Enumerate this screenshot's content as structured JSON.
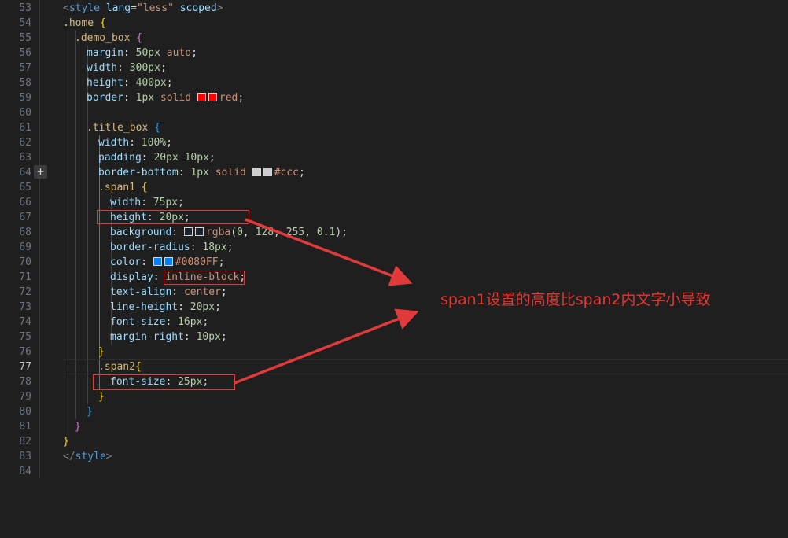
{
  "editor": {
    "current_line": 77,
    "fold_icon": "plus-icon",
    "lines": [
      {
        "n": "53",
        "indent": 80,
        "tokens": [
          {
            "t": "<",
            "c": "c-punct"
          },
          {
            "t": "style",
            "c": "c-tag"
          },
          {
            "t": " ",
            "c": "c-text"
          },
          {
            "t": "lang",
            "c": "c-attr"
          },
          {
            "t": "=",
            "c": "c-text"
          },
          {
            "t": "\"less\"",
            "c": "c-str"
          },
          {
            "t": " ",
            "c": "c-text"
          },
          {
            "t": "scoped",
            "c": "c-attr"
          },
          {
            "t": ">",
            "c": "c-punct"
          }
        ]
      },
      {
        "n": "54",
        "indent": 80,
        "tokens": [
          {
            "t": ".home",
            "c": "c-sel"
          },
          {
            "t": " ",
            "c": "c-text"
          },
          {
            "t": "{",
            "c": "c-b1"
          }
        ]
      },
      {
        "n": "55",
        "indent": 95,
        "tokens": [
          {
            "t": ".demo_box",
            "c": "c-sel"
          },
          {
            "t": " ",
            "c": "c-text"
          },
          {
            "t": "{",
            "c": "c-b2"
          }
        ]
      },
      {
        "n": "56",
        "indent": 110,
        "tokens": [
          {
            "t": "margin",
            "c": "c-prop"
          },
          {
            "t": ": ",
            "c": "c-text"
          },
          {
            "t": "50px",
            "c": "c-num"
          },
          {
            "t": " ",
            "c": "c-text"
          },
          {
            "t": "auto",
            "c": "c-val"
          },
          {
            "t": ";",
            "c": "c-text"
          }
        ]
      },
      {
        "n": "57",
        "indent": 110,
        "tokens": [
          {
            "t": "width",
            "c": "c-prop"
          },
          {
            "t": ": ",
            "c": "c-text"
          },
          {
            "t": "300px",
            "c": "c-num"
          },
          {
            "t": ";",
            "c": "c-text"
          }
        ]
      },
      {
        "n": "58",
        "indent": 110,
        "tokens": [
          {
            "t": "height",
            "c": "c-prop"
          },
          {
            "t": ": ",
            "c": "c-text"
          },
          {
            "t": "400px",
            "c": "c-num"
          },
          {
            "t": ";",
            "c": "c-text"
          }
        ]
      },
      {
        "n": "59",
        "indent": 110,
        "tokens": [
          {
            "t": "border",
            "c": "c-prop"
          },
          {
            "t": ": ",
            "c": "c-text"
          },
          {
            "t": "1px",
            "c": "c-num"
          },
          {
            "t": " ",
            "c": "c-text"
          },
          {
            "t": "solid",
            "c": "c-val"
          },
          {
            "t": " ",
            "c": "c-text"
          },
          {
            "swatch": "#ff0000"
          },
          {
            "swatch": "#ff0000"
          },
          {
            "t": "red",
            "c": "c-val"
          },
          {
            "t": ";",
            "c": "c-text"
          }
        ]
      },
      {
        "n": "60",
        "indent": 110,
        "tokens": []
      },
      {
        "n": "61",
        "indent": 110,
        "tokens": [
          {
            "t": ".title_box",
            "c": "c-sel"
          },
          {
            "t": " ",
            "c": "c-text"
          },
          {
            "t": "{",
            "c": "c-b3"
          }
        ]
      },
      {
        "n": "62",
        "indent": 125,
        "tokens": [
          {
            "t": "width",
            "c": "c-prop"
          },
          {
            "t": ": ",
            "c": "c-text"
          },
          {
            "t": "100%",
            "c": "c-num"
          },
          {
            "t": ";",
            "c": "c-text"
          }
        ]
      },
      {
        "n": "63",
        "indent": 125,
        "tokens": [
          {
            "t": "padding",
            "c": "c-prop"
          },
          {
            "t": ": ",
            "c": "c-text"
          },
          {
            "t": "20px",
            "c": "c-num"
          },
          {
            "t": " ",
            "c": "c-text"
          },
          {
            "t": "10px",
            "c": "c-num"
          },
          {
            "t": ";",
            "c": "c-text"
          }
        ]
      },
      {
        "n": "64",
        "indent": 125,
        "tokens": [
          {
            "t": "border-bottom",
            "c": "c-prop"
          },
          {
            "t": ": ",
            "c": "c-text"
          },
          {
            "t": "1px",
            "c": "c-num"
          },
          {
            "t": " ",
            "c": "c-text"
          },
          {
            "t": "solid",
            "c": "c-val"
          },
          {
            "t": " ",
            "c": "c-text"
          },
          {
            "swatch": "#cccccc"
          },
          {
            "swatch": "#cccccc"
          },
          {
            "t": "#ccc",
            "c": "c-val"
          },
          {
            "t": ";",
            "c": "c-text"
          }
        ]
      },
      {
        "n": "65",
        "indent": 125,
        "tokens": [
          {
            "t": ".span1",
            "c": "c-sel"
          },
          {
            "t": " ",
            "c": "c-text"
          },
          {
            "t": "{",
            "c": "c-b1"
          }
        ]
      },
      {
        "n": "66",
        "indent": 140,
        "tokens": [
          {
            "t": "width",
            "c": "c-prop"
          },
          {
            "t": ": ",
            "c": "c-text"
          },
          {
            "t": "75px",
            "c": "c-num"
          },
          {
            "t": ";",
            "c": "c-text"
          }
        ]
      },
      {
        "n": "67",
        "indent": 140,
        "tokens": [
          {
            "t": "height",
            "c": "c-prop"
          },
          {
            "t": ": ",
            "c": "c-text"
          },
          {
            "t": "20px",
            "c": "c-num"
          },
          {
            "t": ";",
            "c": "c-text"
          }
        ]
      },
      {
        "n": "68",
        "indent": 140,
        "tokens": [
          {
            "t": "background",
            "c": "c-prop"
          },
          {
            "t": ": ",
            "c": "c-text"
          },
          {
            "swatch": "#1a2430"
          },
          {
            "swatch": "#1a2430"
          },
          {
            "t": "rgba",
            "c": "c-val"
          },
          {
            "t": "(",
            "c": "c-text"
          },
          {
            "t": "0",
            "c": "c-num"
          },
          {
            "t": ", ",
            "c": "c-text"
          },
          {
            "t": "128",
            "c": "c-num"
          },
          {
            "t": ", ",
            "c": "c-text"
          },
          {
            "t": "255",
            "c": "c-num"
          },
          {
            "t": ", ",
            "c": "c-text"
          },
          {
            "t": "0.1",
            "c": "c-num"
          },
          {
            "t": ");",
            "c": "c-text"
          }
        ]
      },
      {
        "n": "69",
        "indent": 140,
        "tokens": [
          {
            "t": "border-radius",
            "c": "c-prop"
          },
          {
            "t": ": ",
            "c": "c-text"
          },
          {
            "t": "18px",
            "c": "c-num"
          },
          {
            "t": ";",
            "c": "c-text"
          }
        ]
      },
      {
        "n": "70",
        "indent": 140,
        "tokens": [
          {
            "t": "color",
            "c": "c-prop"
          },
          {
            "t": ": ",
            "c": "c-text"
          },
          {
            "swatch": "#0080ff"
          },
          {
            "swatch": "#0080ff"
          },
          {
            "t": "#0080FF",
            "c": "c-val"
          },
          {
            "t": ";",
            "c": "c-text"
          }
        ]
      },
      {
        "n": "71",
        "indent": 140,
        "tokens": [
          {
            "t": "display",
            "c": "c-prop"
          },
          {
            "t": ": ",
            "c": "c-text"
          },
          {
            "t": "inline-block",
            "c": "c-val"
          },
          {
            "t": ";",
            "c": "c-text"
          }
        ]
      },
      {
        "n": "72",
        "indent": 140,
        "tokens": [
          {
            "t": "text-align",
            "c": "c-prop"
          },
          {
            "t": ": ",
            "c": "c-text"
          },
          {
            "t": "center",
            "c": "c-val"
          },
          {
            "t": ";",
            "c": "c-text"
          }
        ]
      },
      {
        "n": "73",
        "indent": 140,
        "tokens": [
          {
            "t": "line-height",
            "c": "c-prop"
          },
          {
            "t": ": ",
            "c": "c-text"
          },
          {
            "t": "20px",
            "c": "c-num"
          },
          {
            "t": ";",
            "c": "c-text"
          }
        ]
      },
      {
        "n": "74",
        "indent": 140,
        "tokens": [
          {
            "t": "font-size",
            "c": "c-prop"
          },
          {
            "t": ": ",
            "c": "c-text"
          },
          {
            "t": "16px",
            "c": "c-num"
          },
          {
            "t": ";",
            "c": "c-text"
          }
        ]
      },
      {
        "n": "75",
        "indent": 140,
        "tokens": [
          {
            "t": "margin-right",
            "c": "c-prop"
          },
          {
            "t": ": ",
            "c": "c-text"
          },
          {
            "t": "10px",
            "c": "c-num"
          },
          {
            "t": ";",
            "c": "c-text"
          }
        ]
      },
      {
        "n": "76",
        "indent": 125,
        "tokens": [
          {
            "t": "}",
            "c": "c-b1"
          }
        ]
      },
      {
        "n": "77",
        "indent": 125,
        "tokens": [
          {
            "t": ".span2",
            "c": "c-sel"
          },
          {
            "t": "{",
            "c": "c-b1"
          }
        ]
      },
      {
        "n": "78",
        "indent": 140,
        "tokens": [
          {
            "t": "font-size",
            "c": "c-prop"
          },
          {
            "t": ": ",
            "c": "c-text"
          },
          {
            "t": "25px",
            "c": "c-num"
          },
          {
            "t": ";",
            "c": "c-text"
          }
        ]
      },
      {
        "n": "79",
        "indent": 125,
        "tokens": [
          {
            "t": "}",
            "c": "c-b1"
          }
        ]
      },
      {
        "n": "80",
        "indent": 110,
        "tokens": [
          {
            "t": "}",
            "c": "c-b3"
          }
        ]
      },
      {
        "n": "81",
        "indent": 95,
        "tokens": [
          {
            "t": "}",
            "c": "c-b2"
          }
        ]
      },
      {
        "n": "82",
        "indent": 80,
        "tokens": [
          {
            "t": "}",
            "c": "c-b1"
          }
        ]
      },
      {
        "n": "83",
        "indent": 80,
        "tokens": [
          {
            "t": "</",
            "c": "c-punct"
          },
          {
            "t": "style",
            "c": "c-tag"
          },
          {
            "t": ">",
            "c": "c-punct"
          }
        ]
      },
      {
        "n": "84",
        "indent": 80,
        "tokens": []
      }
    ]
  },
  "annotation": {
    "note": "span1设置的高度比span2内文字小导致",
    "color": "#e8352f"
  }
}
